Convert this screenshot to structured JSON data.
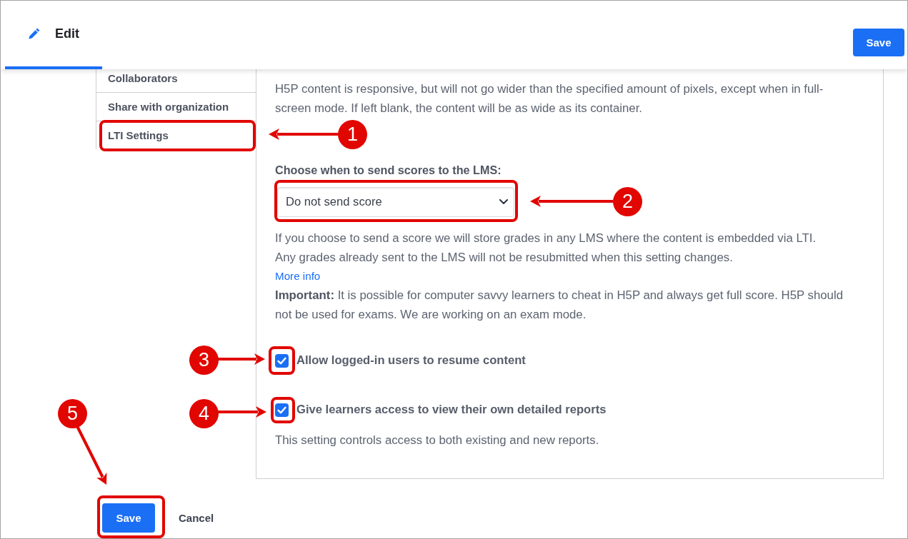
{
  "header": {
    "tabs": [
      {
        "label": "Edit",
        "selected": true
      }
    ],
    "save_button": "Save"
  },
  "sidebar": {
    "items": [
      {
        "label": "Collaborators",
        "selected": false
      },
      {
        "label": "Share with organization",
        "selected": false
      },
      {
        "label": "LTI Settings",
        "selected": false
      }
    ]
  },
  "settings": {
    "width_help": "H5P content is responsive, but will not go wider than the specified amount of pixels, except when in full-screen mode. If left blank, the content will be as wide as its container.",
    "score_label": "Choose when to send scores to the LMS:",
    "score_select": {
      "value": "Do not send score"
    },
    "score_help": [
      "If you choose to send a score we will store grades in any LMS where the content is embedded via LTI.",
      "Any grades already sent to the LMS will not be resubmitted when this setting changes."
    ],
    "more_info_link": "More info",
    "important": "**Important:** It is possible for computer savvy learners to cheat in H5P and always get full score. H5P should not be used for exams. We are working on an exam mode.",
    "options": [
      {
        "label": "Allow logged-in users to resume content",
        "checked": true
      },
      {
        "label": "Give learners access to view their own detailed reports",
        "checked": true,
        "note": "This setting controls access to both existing and new reports."
      }
    ]
  },
  "footer": {
    "save_button": "Save",
    "cancel_link": "Cancel"
  },
  "annotations": [
    {
      "number": "1"
    },
    {
      "number": "2"
    },
    {
      "number": "3"
    },
    {
      "number": "4"
    },
    {
      "number": "5"
    }
  ]
}
